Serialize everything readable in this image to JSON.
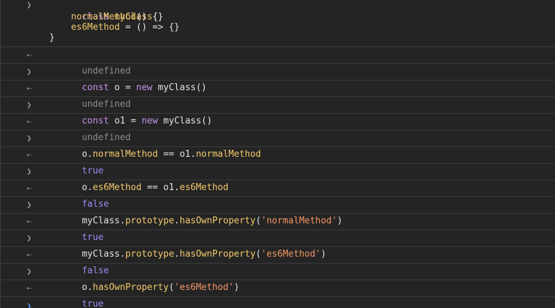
{
  "console": {
    "entries": [
      {
        "kind": "input",
        "lines": [
          "class myClass{",
          "    normalMethod() {}",
          "    es6Method = () => {}",
          "}"
        ]
      },
      {
        "kind": "result",
        "text": "undefined"
      },
      {
        "kind": "input",
        "text": "const o = new myClass()"
      },
      {
        "kind": "result",
        "text": "undefined"
      },
      {
        "kind": "input",
        "text": "const o1 = new myClass()"
      },
      {
        "kind": "result",
        "text": "undefined"
      },
      {
        "kind": "input",
        "text": "o.normalMethod == o1.normalMethod"
      },
      {
        "kind": "result",
        "text": "true"
      },
      {
        "kind": "input",
        "text": "o.es6Method == o1.es6Method"
      },
      {
        "kind": "result",
        "text": "false"
      },
      {
        "kind": "input",
        "text": "myClass.prototype.hasOwnProperty('normalMethod')"
      },
      {
        "kind": "result",
        "text": "true"
      },
      {
        "kind": "input",
        "text": "myClass.prototype.hasOwnProperty('es6Method')"
      },
      {
        "kind": "result",
        "text": "false"
      },
      {
        "kind": "input",
        "text": "o.hasOwnProperty('es6Method')"
      },
      {
        "kind": "result",
        "text": "true"
      }
    ],
    "input_prompt_icon": "chevron-right-icon",
    "result_prompt_icon": "return-arrow-icon",
    "active_prompt_icon": "chevron-right-icon"
  },
  "tokens": {
    "class_kw": "class",
    "class_name": "myClass",
    "open_brace": "{",
    "normal_method_line": "normalMethod",
    "normal_method_tail": "() {}",
    "es6_method_name": "es6Method",
    "es6_method_tail": " = () => {}",
    "close_brace": "}",
    "const_kw": "const",
    "new_kw": "new",
    "o_decl": " o = ",
    "o1_decl": " o1 = ",
    "myclass_call": " myClass()",
    "o_dot": "o.",
    "o1_dot": "o1.",
    "eq": " == ",
    "normalMethod": "normalMethod",
    "es6Method": "es6Method",
    "myClass_dot": "myClass.",
    "prototype": "prototype",
    "dot": ".",
    "hasOwnProperty": "hasOwnProperty",
    "lparen": "(",
    "rparen": ")",
    "str_normal": "'normalMethod'",
    "str_es6": "'es6Method'",
    "undefined": "undefined",
    "true": "true",
    "false": "false"
  },
  "colors": {
    "background": "#242424",
    "keyword": "#c792ea",
    "method": "#f2c96b",
    "string": "#f29766",
    "undefined": "#8c8c8c",
    "boolean": "#9b8cf2",
    "active_prompt": "#4f9cf5"
  }
}
